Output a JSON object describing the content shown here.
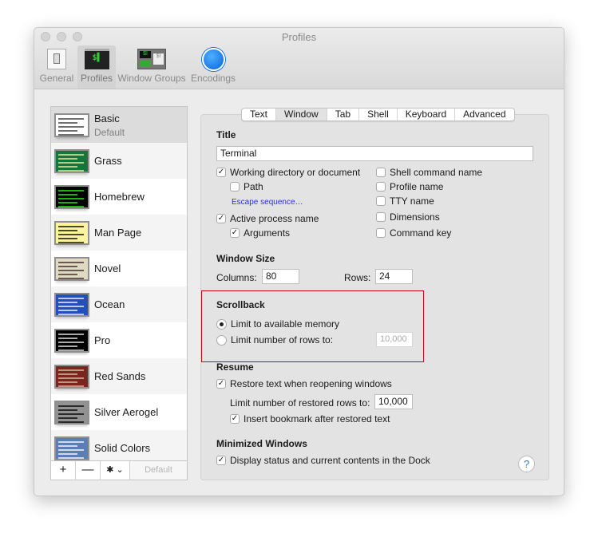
{
  "window": {
    "title": "Profiles"
  },
  "toolbar": [
    {
      "label": "General",
      "icon": "general-switch-icon"
    },
    {
      "label": "Profiles",
      "icon": "terminal-icon",
      "selected": true
    },
    {
      "label": "Window Groups",
      "icon": "window-groups-icon"
    },
    {
      "label": "Encodings",
      "icon": "globe-icon"
    }
  ],
  "profiles": [
    {
      "name": "Basic",
      "subtitle": "Default",
      "bg": "#ffffff",
      "fg": "#333333",
      "selected": true
    },
    {
      "name": "Grass",
      "bg": "#13773d",
      "fg": "#fff0a5"
    },
    {
      "name": "Homebrew",
      "bg": "#000000",
      "fg": "#28fe14"
    },
    {
      "name": "Man Page",
      "bg": "#fef49c",
      "fg": "#000000"
    },
    {
      "name": "Novel",
      "bg": "#dfdbc3",
      "fg": "#3b2322"
    },
    {
      "name": "Ocean",
      "bg": "#224fbc",
      "fg": "#ffffff"
    },
    {
      "name": "Pro",
      "bg": "#000000",
      "fg": "#f2f2f2"
    },
    {
      "name": "Red Sands",
      "bg": "#7a251e",
      "fg": "#d7c9a7"
    },
    {
      "name": "Silver Aerogel",
      "bg": "#929292",
      "fg": "#000000"
    },
    {
      "name": "Solid Colors",
      "bg": "#5b7fb4",
      "fg": "#ffffff"
    }
  ],
  "list_bar": {
    "add": "+",
    "remove": "—",
    "gear": "✱ ⌄",
    "default": "Default"
  },
  "tabs": [
    {
      "label": "Text"
    },
    {
      "label": "Window",
      "selected": true
    },
    {
      "label": "Tab"
    },
    {
      "label": "Shell"
    },
    {
      "label": "Keyboard"
    },
    {
      "label": "Advanced"
    }
  ],
  "title_section": {
    "heading": "Title",
    "value": "Terminal",
    "left": [
      {
        "label": "Working directory or document",
        "checked": true
      },
      {
        "label": "Path",
        "checked": false
      },
      {
        "label": "Active process name",
        "checked": true
      },
      {
        "label": "Arguments",
        "checked": true
      }
    ],
    "escape_link": "Escape sequence…",
    "right": [
      {
        "label": "Shell command name",
        "checked": false
      },
      {
        "label": "Profile name",
        "checked": false
      },
      {
        "label": "TTY name",
        "checked": false
      },
      {
        "label": "Dimensions",
        "checked": false
      },
      {
        "label": "Command key",
        "checked": false
      }
    ]
  },
  "window_size": {
    "heading": "Window Size",
    "columns_label": "Columns:",
    "columns": "80",
    "rows_label": "Rows:",
    "rows": "24"
  },
  "scrollback": {
    "heading": "Scrollback",
    "opt1": "Limit to available memory",
    "opt2": "Limit number of rows to:",
    "rows_value": "10,000",
    "selected": "opt1",
    "highlight_color": "#d0021b"
  },
  "resume": {
    "heading": "Resume",
    "restore": "Restore text when reopening windows",
    "limit_label": "Limit number of restored rows to:",
    "limit_value": "10,000",
    "bookmark": "Insert bookmark after restored text"
  },
  "minimized": {
    "heading": "Minimized Windows",
    "display": "Display status and current contents in the Dock"
  },
  "help": "?"
}
